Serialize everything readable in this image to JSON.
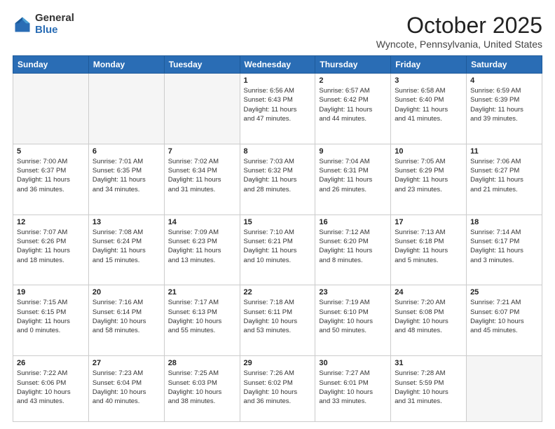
{
  "header": {
    "logo_general": "General",
    "logo_blue": "Blue",
    "month_title": "October 2025",
    "location": "Wyncote, Pennsylvania, United States"
  },
  "days_of_week": [
    "Sunday",
    "Monday",
    "Tuesday",
    "Wednesday",
    "Thursday",
    "Friday",
    "Saturday"
  ],
  "weeks": [
    [
      {
        "day": "",
        "info": "",
        "empty": true
      },
      {
        "day": "",
        "info": "",
        "empty": true
      },
      {
        "day": "",
        "info": "",
        "empty": true
      },
      {
        "day": "1",
        "info": "Sunrise: 6:56 AM\nSunset: 6:43 PM\nDaylight: 11 hours\nand 47 minutes."
      },
      {
        "day": "2",
        "info": "Sunrise: 6:57 AM\nSunset: 6:42 PM\nDaylight: 11 hours\nand 44 minutes."
      },
      {
        "day": "3",
        "info": "Sunrise: 6:58 AM\nSunset: 6:40 PM\nDaylight: 11 hours\nand 41 minutes."
      },
      {
        "day": "4",
        "info": "Sunrise: 6:59 AM\nSunset: 6:39 PM\nDaylight: 11 hours\nand 39 minutes."
      }
    ],
    [
      {
        "day": "5",
        "info": "Sunrise: 7:00 AM\nSunset: 6:37 PM\nDaylight: 11 hours\nand 36 minutes."
      },
      {
        "day": "6",
        "info": "Sunrise: 7:01 AM\nSunset: 6:35 PM\nDaylight: 11 hours\nand 34 minutes."
      },
      {
        "day": "7",
        "info": "Sunrise: 7:02 AM\nSunset: 6:34 PM\nDaylight: 11 hours\nand 31 minutes."
      },
      {
        "day": "8",
        "info": "Sunrise: 7:03 AM\nSunset: 6:32 PM\nDaylight: 11 hours\nand 28 minutes."
      },
      {
        "day": "9",
        "info": "Sunrise: 7:04 AM\nSunset: 6:31 PM\nDaylight: 11 hours\nand 26 minutes."
      },
      {
        "day": "10",
        "info": "Sunrise: 7:05 AM\nSunset: 6:29 PM\nDaylight: 11 hours\nand 23 minutes."
      },
      {
        "day": "11",
        "info": "Sunrise: 7:06 AM\nSunset: 6:27 PM\nDaylight: 11 hours\nand 21 minutes."
      }
    ],
    [
      {
        "day": "12",
        "info": "Sunrise: 7:07 AM\nSunset: 6:26 PM\nDaylight: 11 hours\nand 18 minutes."
      },
      {
        "day": "13",
        "info": "Sunrise: 7:08 AM\nSunset: 6:24 PM\nDaylight: 11 hours\nand 15 minutes."
      },
      {
        "day": "14",
        "info": "Sunrise: 7:09 AM\nSunset: 6:23 PM\nDaylight: 11 hours\nand 13 minutes."
      },
      {
        "day": "15",
        "info": "Sunrise: 7:10 AM\nSunset: 6:21 PM\nDaylight: 11 hours\nand 10 minutes."
      },
      {
        "day": "16",
        "info": "Sunrise: 7:12 AM\nSunset: 6:20 PM\nDaylight: 11 hours\nand 8 minutes."
      },
      {
        "day": "17",
        "info": "Sunrise: 7:13 AM\nSunset: 6:18 PM\nDaylight: 11 hours\nand 5 minutes."
      },
      {
        "day": "18",
        "info": "Sunrise: 7:14 AM\nSunset: 6:17 PM\nDaylight: 11 hours\nand 3 minutes."
      }
    ],
    [
      {
        "day": "19",
        "info": "Sunrise: 7:15 AM\nSunset: 6:15 PM\nDaylight: 11 hours\nand 0 minutes."
      },
      {
        "day": "20",
        "info": "Sunrise: 7:16 AM\nSunset: 6:14 PM\nDaylight: 10 hours\nand 58 minutes."
      },
      {
        "day": "21",
        "info": "Sunrise: 7:17 AM\nSunset: 6:13 PM\nDaylight: 10 hours\nand 55 minutes."
      },
      {
        "day": "22",
        "info": "Sunrise: 7:18 AM\nSunset: 6:11 PM\nDaylight: 10 hours\nand 53 minutes."
      },
      {
        "day": "23",
        "info": "Sunrise: 7:19 AM\nSunset: 6:10 PM\nDaylight: 10 hours\nand 50 minutes."
      },
      {
        "day": "24",
        "info": "Sunrise: 7:20 AM\nSunset: 6:08 PM\nDaylight: 10 hours\nand 48 minutes."
      },
      {
        "day": "25",
        "info": "Sunrise: 7:21 AM\nSunset: 6:07 PM\nDaylight: 10 hours\nand 45 minutes."
      }
    ],
    [
      {
        "day": "26",
        "info": "Sunrise: 7:22 AM\nSunset: 6:06 PM\nDaylight: 10 hours\nand 43 minutes."
      },
      {
        "day": "27",
        "info": "Sunrise: 7:23 AM\nSunset: 6:04 PM\nDaylight: 10 hours\nand 40 minutes."
      },
      {
        "day": "28",
        "info": "Sunrise: 7:25 AM\nSunset: 6:03 PM\nDaylight: 10 hours\nand 38 minutes."
      },
      {
        "day": "29",
        "info": "Sunrise: 7:26 AM\nSunset: 6:02 PM\nDaylight: 10 hours\nand 36 minutes."
      },
      {
        "day": "30",
        "info": "Sunrise: 7:27 AM\nSunset: 6:01 PM\nDaylight: 10 hours\nand 33 minutes."
      },
      {
        "day": "31",
        "info": "Sunrise: 7:28 AM\nSunset: 5:59 PM\nDaylight: 10 hours\nand 31 minutes."
      },
      {
        "day": "",
        "info": "",
        "empty": true
      }
    ]
  ]
}
